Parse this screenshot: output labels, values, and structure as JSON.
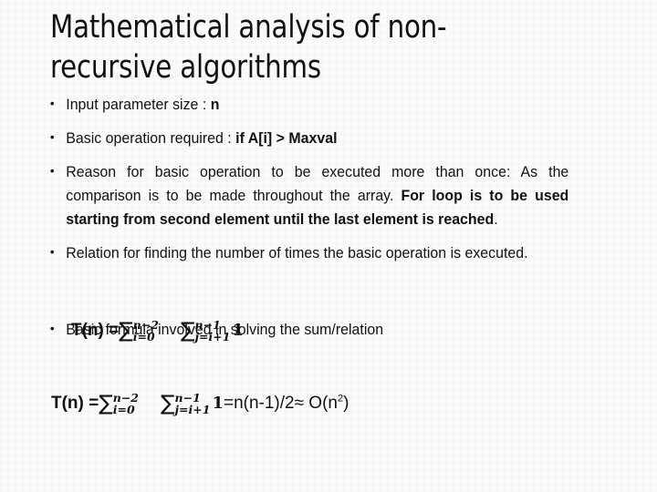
{
  "slide": {
    "title": "Mathematical analysis of non-recursive algorithms",
    "background_color": "#fbfbfc",
    "text_color": "#111111",
    "bullet_glyph": "•",
    "bullets": [
      {
        "id": "input-parameter-size",
        "plain": "Input parameter size : n",
        "segments": [
          {
            "text": "Input parameter size : ",
            "bold": false
          },
          {
            "text": "n",
            "bold": true
          }
        ]
      },
      {
        "id": "basic-operation-required",
        "plain": "Basic operation required : if A[i] > Maxval",
        "segments": [
          {
            "text": "Basic operation required : ",
            "bold": false
          },
          {
            "text": "if A[i] > Maxval",
            "bold": true
          }
        ]
      },
      {
        "id": "reason-for-basic-operation",
        "plain": "Reason for basic operation to be executed more than once: As the comparison is to be made throughout the array. For loop is to be used starting from second element until the last element is reached.",
        "segments": [
          {
            "text": "Reason for basic operation to be executed more than once: As the comparison is to be made throughout the array. ",
            "bold": false
          },
          {
            "text": "For loop is to be used starting from second element until the last element is reached",
            "bold": true
          },
          {
            "text": ".",
            "bold": false
          }
        ]
      },
      {
        "id": "relation-for-finding-number-of-times",
        "plain": "Relation for finding the number of times the basic operation is executed.",
        "segments": [
          {
            "text": "Relation for finding the number of times the basic operation is executed.",
            "bold": false
          }
        ]
      },
      {
        "id": "basic-formula-involved",
        "plain": "Basic formula involved in solving the sum/relation",
        "segments": [
          {
            "text": "Basic formula involved in solving the sum/relation",
            "bold": false
          }
        ]
      }
    ],
    "formulas": [
      {
        "id": "relation-formula",
        "lead": "T(n) =",
        "sum1": {
          "symbol": "∑",
          "upper": "n−2",
          "lower": "i=0"
        },
        "sum2": {
          "symbol": "∑",
          "upper": "n−1",
          "lower": "j=i+1"
        },
        "summand": "1",
        "tail": "",
        "tail_sup": "",
        "plain": "T(n) =∑(i=0)^(n−2) ∑(j=i+1)^(n−1) 1"
      },
      {
        "id": "solved-formula",
        "lead": "T(n) =",
        "sum1": {
          "symbol": "∑",
          "upper": "n−2",
          "lower": "i=0"
        },
        "sum2": {
          "symbol": "∑",
          "upper": "n−1",
          "lower": "j=i+1"
        },
        "summand": "1",
        "tail": "=n(n-1)/2≈ O(n",
        "tail_sup": "2",
        "tail_end": ")",
        "plain": "T(n) =∑(i=0)^(n−2) ∑(j=i+1)^(n−1) 1=n(n-1)/2≈ O(n²)"
      }
    ]
  }
}
